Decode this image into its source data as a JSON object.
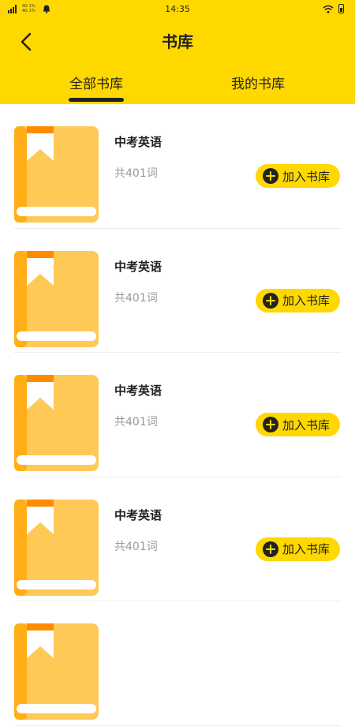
{
  "status_bar": {
    "time": "14:35",
    "carrier_text": [
      "4G 1%",
      "4G 1%"
    ]
  },
  "header": {
    "title": "书库"
  },
  "tabs": [
    {
      "label": "全部书库",
      "active": true
    },
    {
      "label": "我的书库",
      "active": false
    }
  ],
  "books": [
    {
      "name": "中考英语",
      "count": "共401词",
      "button": "加入书库"
    },
    {
      "name": "中考英语",
      "count": "共401词",
      "button": "加入书库"
    },
    {
      "name": "中考英语",
      "count": "共401词",
      "button": "加入书库"
    },
    {
      "name": "中考英语",
      "count": "共401词",
      "button": "加入书库"
    },
    {
      "name": "",
      "count": "",
      "button": ""
    }
  ],
  "colors": {
    "brand": "#FFD800",
    "book_main": "#FFC958",
    "book_spine": "#FFAE17",
    "book_ribbon": "#FF8C00"
  },
  "icons": [
    "signal-icon",
    "notification-bell-icon",
    "wifi-icon",
    "battery-icon",
    "back-arrow-icon",
    "book-icon",
    "plus-circle-icon"
  ]
}
